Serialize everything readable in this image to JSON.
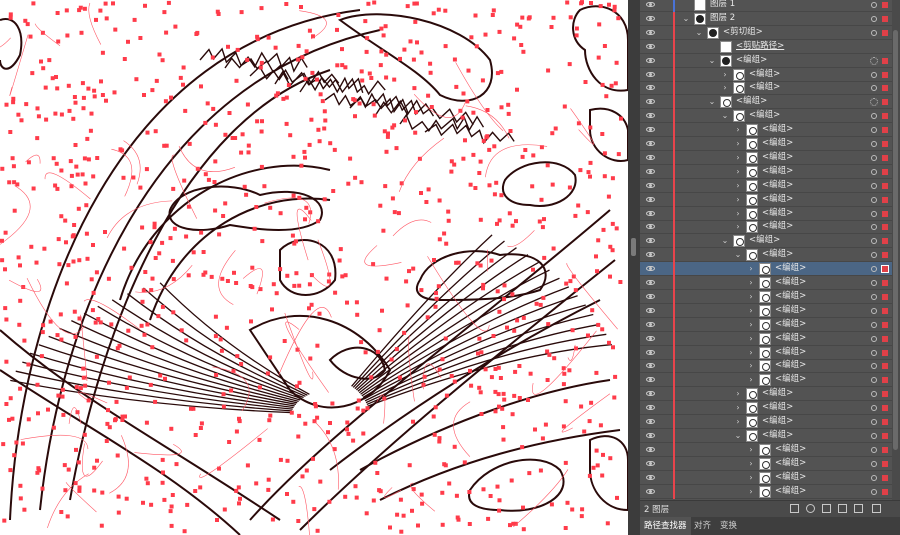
{
  "layers": [
    {
      "name": "图层 1",
      "indent": 0,
      "chevron": "",
      "thumb": "plain",
      "bar": "blue",
      "target": "single"
    },
    {
      "name": "图层 2",
      "indent": 0,
      "chevron": "⌄",
      "thumb": "hex",
      "bar": "red",
      "target": "single"
    },
    {
      "name": "<剪切组>",
      "indent": 1,
      "chevron": "⌄",
      "thumb": "hex",
      "bar": "red",
      "target": "single"
    },
    {
      "name": "<剪贴路径>",
      "indent": 2,
      "chevron": "",
      "thumb": "plain",
      "bar": "red",
      "target": "none",
      "underline": true
    },
    {
      "name": "<编组>",
      "indent": 2,
      "chevron": "⌄",
      "thumb": "hex",
      "bar": "red",
      "target": "double"
    },
    {
      "name": "<编组>",
      "indent": 3,
      "chevron": "›",
      "thumb": "dark",
      "bar": "red",
      "target": "single"
    },
    {
      "name": "<编组>",
      "indent": 3,
      "chevron": "›",
      "thumb": "dark",
      "bar": "red",
      "target": "single"
    },
    {
      "name": "<编组>",
      "indent": 2,
      "chevron": "⌄",
      "thumb": "dark",
      "bar": "red",
      "target": "double"
    },
    {
      "name": "<编组>",
      "indent": 3,
      "chevron": "⌄",
      "thumb": "dark",
      "bar": "red",
      "target": "single"
    },
    {
      "name": "<编组>",
      "indent": 4,
      "chevron": "›",
      "thumb": "dark",
      "bar": "red",
      "target": "single"
    },
    {
      "name": "<编组>",
      "indent": 4,
      "chevron": "›",
      "thumb": "dark",
      "bar": "red",
      "target": "single"
    },
    {
      "name": "<编组>",
      "indent": 4,
      "chevron": "›",
      "thumb": "dark",
      "bar": "red",
      "target": "single"
    },
    {
      "name": "<编组>",
      "indent": 4,
      "chevron": "›",
      "thumb": "dark",
      "bar": "red",
      "target": "single"
    },
    {
      "name": "<编组>",
      "indent": 4,
      "chevron": "›",
      "thumb": "dark",
      "bar": "red",
      "target": "single"
    },
    {
      "name": "<编组>",
      "indent": 4,
      "chevron": "›",
      "thumb": "dark",
      "bar": "red",
      "target": "single"
    },
    {
      "name": "<编组>",
      "indent": 4,
      "chevron": "›",
      "thumb": "dark",
      "bar": "red",
      "target": "single"
    },
    {
      "name": "<编组>",
      "indent": 4,
      "chevron": "›",
      "thumb": "dark",
      "bar": "red",
      "target": "single"
    },
    {
      "name": "<编组>",
      "indent": 3,
      "chevron": "⌄",
      "thumb": "dark",
      "bar": "red",
      "target": "single"
    },
    {
      "name": "<编组>",
      "indent": 4,
      "chevron": "⌄",
      "thumb": "dark",
      "bar": "red",
      "target": "single"
    },
    {
      "name": "<编组>",
      "indent": 5,
      "chevron": "›",
      "thumb": "dark",
      "bar": "red",
      "target": "single",
      "selected": true
    },
    {
      "name": "<编组>",
      "indent": 5,
      "chevron": "›",
      "thumb": "dark",
      "bar": "red",
      "target": "single"
    },
    {
      "name": "<编组>",
      "indent": 5,
      "chevron": "›",
      "thumb": "dark",
      "bar": "red",
      "target": "single"
    },
    {
      "name": "<编组>",
      "indent": 5,
      "chevron": "›",
      "thumb": "dark",
      "bar": "red",
      "target": "single"
    },
    {
      "name": "<编组>",
      "indent": 5,
      "chevron": "›",
      "thumb": "dark",
      "bar": "red",
      "target": "single"
    },
    {
      "name": "<编组>",
      "indent": 5,
      "chevron": "›",
      "thumb": "dark",
      "bar": "red",
      "target": "single"
    },
    {
      "name": "<编组>",
      "indent": 5,
      "chevron": "›",
      "thumb": "dark",
      "bar": "red",
      "target": "single"
    },
    {
      "name": "<编组>",
      "indent": 5,
      "chevron": "›",
      "thumb": "dark",
      "bar": "red",
      "target": "single"
    },
    {
      "name": "<编组>",
      "indent": 5,
      "chevron": "›",
      "thumb": "dark",
      "bar": "red",
      "target": "single"
    },
    {
      "name": "<编组>",
      "indent": 4,
      "chevron": "›",
      "thumb": "dark",
      "bar": "red",
      "target": "single"
    },
    {
      "name": "<编组>",
      "indent": 4,
      "chevron": "›",
      "thumb": "dark",
      "bar": "red",
      "target": "single"
    },
    {
      "name": "<编组>",
      "indent": 4,
      "chevron": "›",
      "thumb": "dark",
      "bar": "red",
      "target": "single"
    },
    {
      "name": "<编组>",
      "indent": 4,
      "chevron": "⌄",
      "thumb": "dark",
      "bar": "red",
      "target": "single"
    },
    {
      "name": "<编组>",
      "indent": 5,
      "chevron": "›",
      "thumb": "dark",
      "bar": "red",
      "target": "single"
    },
    {
      "name": "<编组>",
      "indent": 5,
      "chevron": "›",
      "thumb": "dark",
      "bar": "red",
      "target": "single"
    },
    {
      "name": "<编组>",
      "indent": 5,
      "chevron": "›",
      "thumb": "dark",
      "bar": "red",
      "target": "single"
    },
    {
      "name": "<编组>",
      "indent": 5,
      "chevron": "›",
      "thumb": "dark",
      "bar": "red",
      "target": "single"
    }
  ],
  "footer": {
    "count_label": "2 图层"
  },
  "tabs": [
    "路径查找器",
    "对齐",
    "变换"
  ],
  "colors": {
    "selection": "#4b6685",
    "layer_color": "#e04048",
    "panel_bg": "#535353"
  }
}
